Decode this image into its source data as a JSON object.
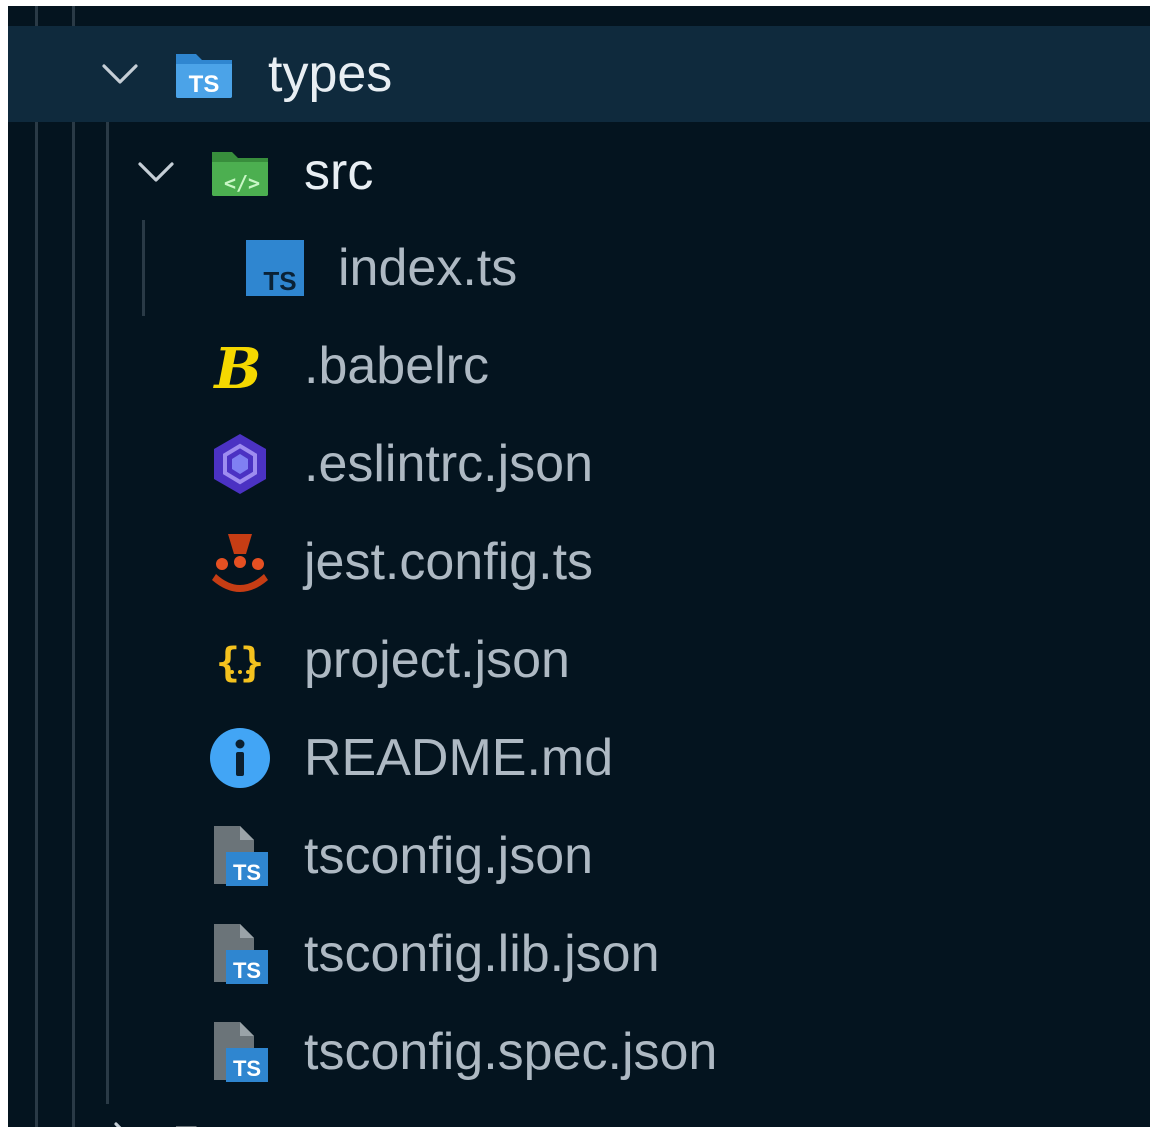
{
  "explorer": {
    "items": [
      {
        "label": "types",
        "kind": "folder",
        "expanded": true,
        "icon": "folder-typescript-icon"
      },
      {
        "label": "src",
        "kind": "folder",
        "expanded": true,
        "icon": "folder-src-icon"
      },
      {
        "label": "index.ts",
        "kind": "file",
        "icon": "typescript-file-icon"
      },
      {
        "label": ".babelrc",
        "kind": "file",
        "icon": "babel-icon"
      },
      {
        "label": ".eslintrc.json",
        "kind": "file",
        "icon": "eslint-icon"
      },
      {
        "label": "jest.config.ts",
        "kind": "file",
        "icon": "jest-icon"
      },
      {
        "label": "project.json",
        "kind": "file",
        "icon": "json-icon"
      },
      {
        "label": "README.md",
        "kind": "file",
        "icon": "info-icon"
      },
      {
        "label": "tsconfig.json",
        "kind": "file",
        "icon": "tsconfig-icon"
      },
      {
        "label": "tsconfig.lib.json",
        "kind": "file",
        "icon": "tsconfig-icon"
      },
      {
        "label": "tsconfig.spec.json",
        "kind": "file",
        "icon": "tsconfig-icon"
      }
    ]
  },
  "colors": {
    "background": "#04141f",
    "selected_row": "#0f2a3d",
    "file_text": "#aeb9c3",
    "folder_text": "#e8eef3",
    "typescript_blue": "#2f86d0",
    "src_green": "#4caf50",
    "babel_yellow": "#f5d800",
    "eslint_purple": "#4b32c3",
    "jest_red": "#c63d14",
    "json_yellow": "#f4c21e",
    "info_blue": "#42a5f5"
  }
}
